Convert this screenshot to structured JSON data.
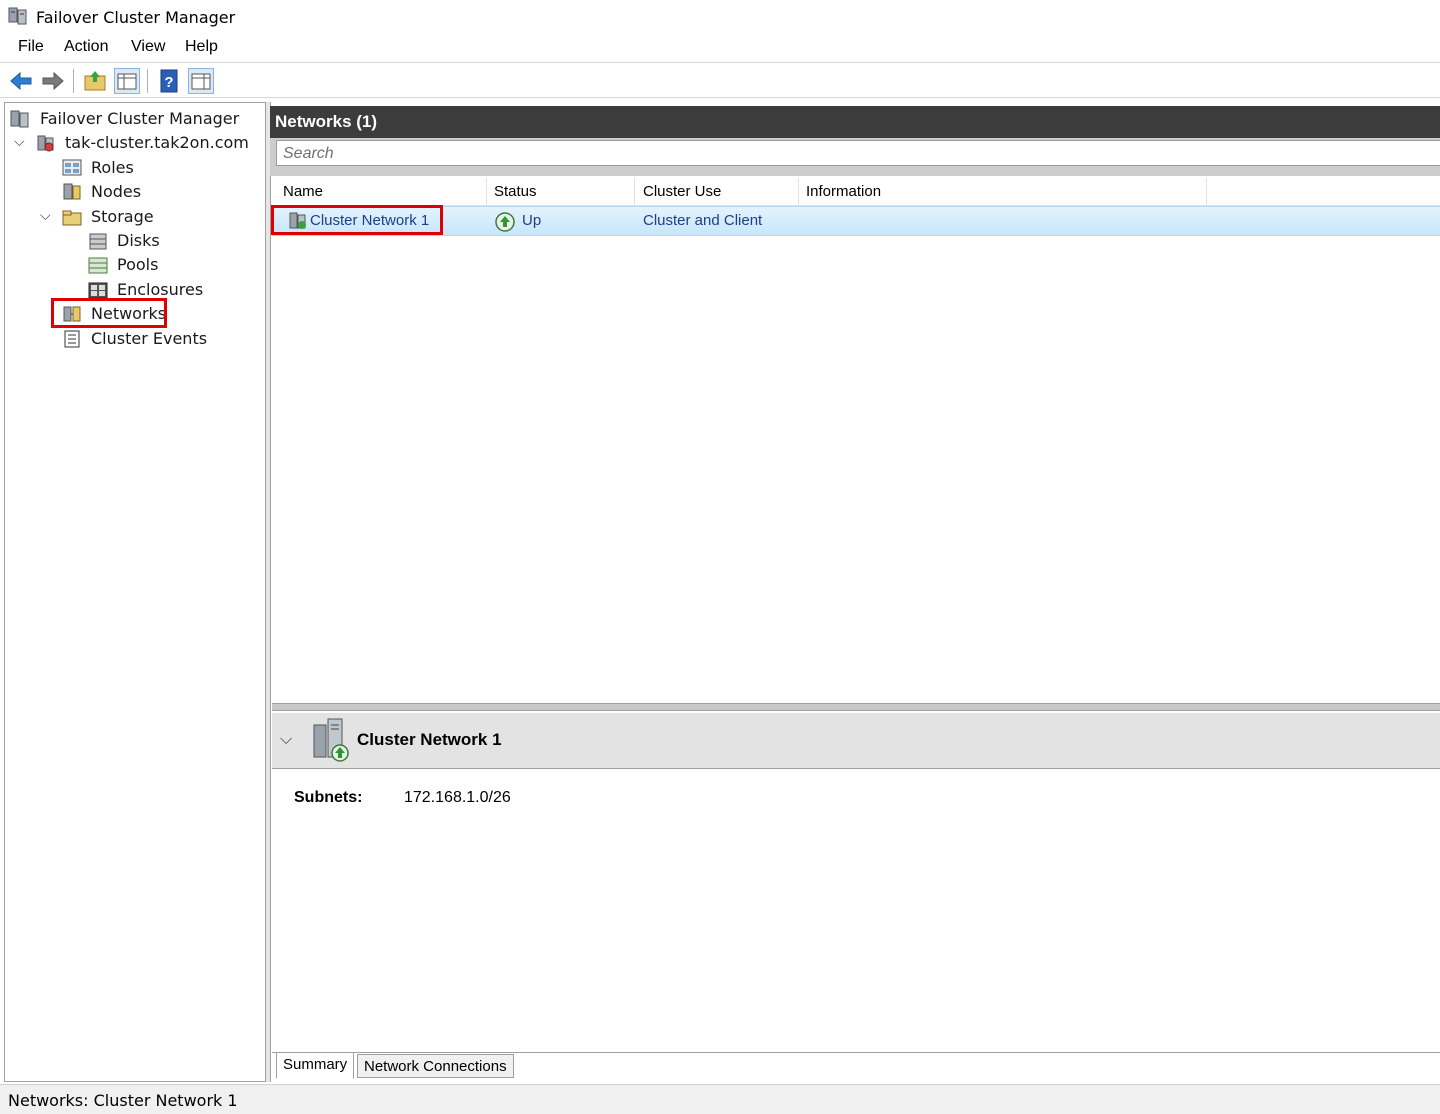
{
  "window": {
    "title": "Failover Cluster Manager"
  },
  "menu": {
    "file": "File",
    "action": "Action",
    "view": "View",
    "help": "Help"
  },
  "toolbar": {
    "icons": [
      "back-arrow-icon",
      "forward-arrow-icon",
      "up-folder-icon",
      "show-hide-console-tree-icon",
      "help-icon",
      "show-hide-action-pane-icon"
    ]
  },
  "tree": {
    "root": "Failover Cluster Manager",
    "cluster": "tak-cluster.tak2on.com",
    "roles": "Roles",
    "nodes": "Nodes",
    "storage": "Storage",
    "disks": "Disks",
    "pools": "Pools",
    "enclosures": "Enclosures",
    "networks": "Networks",
    "cluster_events": "Cluster Events"
  },
  "networks_pane": {
    "header": "Networks (1)",
    "search_placeholder": "Search",
    "columns": {
      "name": "Name",
      "status": "Status",
      "cluster_use": "Cluster Use",
      "information": "Information"
    },
    "rows": [
      {
        "name": "Cluster Network 1",
        "status": "Up",
        "cluster_use": "Cluster and Client",
        "information": ""
      }
    ]
  },
  "detail": {
    "title": "Cluster Network 1",
    "subnets_label": "Subnets:",
    "subnets_value": "172.168.1.0/26",
    "tabs": {
      "summary": "Summary",
      "network_connections": "Network Connections"
    }
  },
  "statusbar": {
    "text": "Networks:  Cluster Network 1"
  },
  "colors": {
    "accent_highlight": "#e00000",
    "selected_row": "#c6e6fb",
    "header_dark": "#3c3c3c"
  }
}
